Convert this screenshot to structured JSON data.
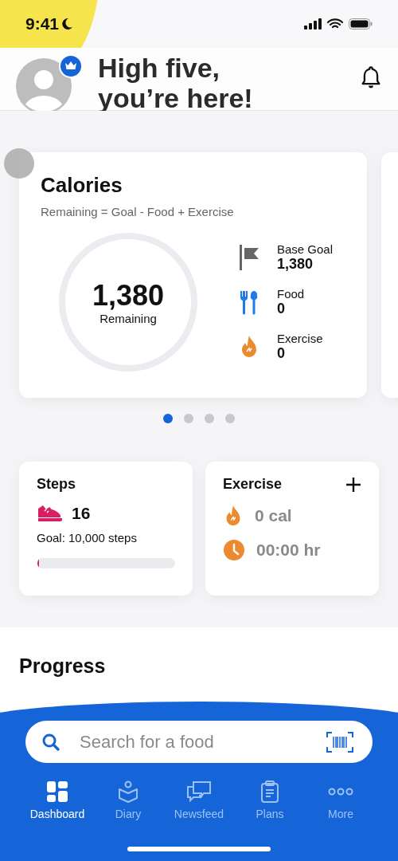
{
  "status_bar": {
    "time": "9:41"
  },
  "header": {
    "greeting": "High five,\nyou’re here!",
    "premium": true
  },
  "calories": {
    "title": "Calories",
    "formula": "Remaining = Goal - Food + Exercise",
    "remaining_value": "1,380",
    "remaining_label": "Remaining",
    "items": [
      {
        "kind": "goal",
        "label": "Base Goal",
        "value": "1,380"
      },
      {
        "kind": "food",
        "label": "Food",
        "value": "0"
      },
      {
        "kind": "exercise",
        "label": "Exercise",
        "value": "0"
      }
    ]
  },
  "pager": [
    {
      "selected": true
    },
    {
      "selected": false
    },
    {
      "selected": false
    },
    {
      "selected": false
    }
  ],
  "steps": {
    "title": "Steps",
    "count": "16",
    "goal": "Goal: 10,000 steps",
    "level": 0.01
  },
  "exercise": {
    "title": "Exercise",
    "items": [
      {
        "kind": "calories",
        "value": "0 cal"
      },
      {
        "kind": "time",
        "value": "00:00 hr"
      }
    ]
  },
  "progress": {
    "title": "Progress"
  },
  "search": {
    "placeholder": "Search for a food"
  },
  "tabs": [
    {
      "label": "Dashboard",
      "selected": true
    },
    {
      "label": "Diary",
      "selected": false
    },
    {
      "label": "Newsfeed",
      "selected": false
    },
    {
      "label": "Plans",
      "selected": false
    },
    {
      "label": "More",
      "selected": false
    }
  ]
}
